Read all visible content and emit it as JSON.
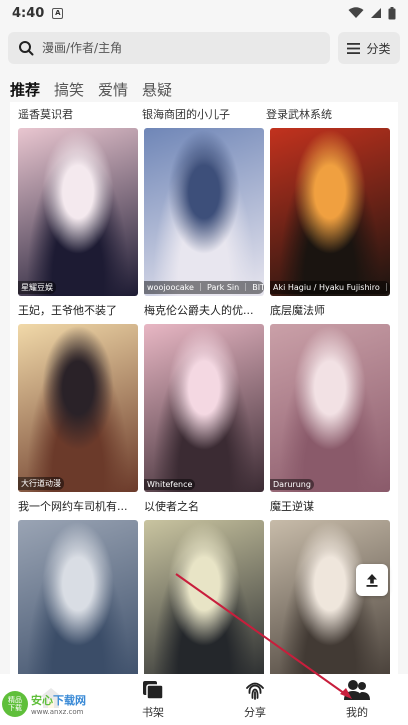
{
  "status_bar": {
    "time": "4:40",
    "notification": "A"
  },
  "search": {
    "placeholder": "漫画/作者/主角"
  },
  "category_button": {
    "label": "分类"
  },
  "tabs": [
    {
      "label": "推荐",
      "active": true
    },
    {
      "label": "搞笑",
      "active": false
    },
    {
      "label": "爱情",
      "active": false
    },
    {
      "label": "悬疑",
      "active": false
    }
  ],
  "previous_titles": [
    "遥香莫识君",
    "银海商团的小儿子",
    "登录武林系统"
  ],
  "comics": [
    {
      "title": "王妃，王爷他不装了",
      "author": "星耀豆娱",
      "colors": [
        "#e9c6d0",
        "#1d1b33",
        "#f4e9ee"
      ]
    },
    {
      "title": "梅克伦公爵夫人的优...",
      "author": "woojoocake ｜ Park Sin ｜ BITL...",
      "colors": [
        "#6f86b7",
        "#e8e6ef",
        "#3d4f7a"
      ]
    },
    {
      "title": "底层魔法师",
      "author": "Aki Hagiu / Hyaku Fujishiro ｜ ...",
      "colors": [
        "#c2321e",
        "#1a1410",
        "#f0a040"
      ]
    },
    {
      "title": "我一个网约车司机有...",
      "author": "大行道动漫",
      "colors": [
        "#f1d9a9",
        "#6b3a2a",
        "#2a2228"
      ]
    },
    {
      "title": "以使者之名",
      "author": "Whitefence",
      "colors": [
        "#e8b7c4",
        "#3b2b33",
        "#f4d8e2"
      ]
    },
    {
      "title": "魔王逆谋",
      "author": "Darurung",
      "colors": [
        "#caa0a8",
        "#8a5a6a",
        "#f2e1e4"
      ]
    },
    {
      "title": "",
      "author": "",
      "colors": [
        "#9aa4b4",
        "#3b4d68",
        "#d9dde4"
      ]
    },
    {
      "title": "",
      "author": "",
      "colors": [
        "#c9c4a0",
        "#24272b",
        "#e8e4c6"
      ]
    },
    {
      "title": "",
      "author": "",
      "colors": [
        "#c7bba9",
        "#423a34",
        "#efe6dc"
      ]
    }
  ],
  "bottom_nav": [
    {
      "label": "",
      "icon": "home-icon",
      "active": true
    },
    {
      "label": "书架",
      "icon": "bookshelf-icon",
      "active": false
    },
    {
      "label": "分享",
      "icon": "fingerprint-icon",
      "active": false
    },
    {
      "label": "我的",
      "icon": "user-icon",
      "active": false
    }
  ],
  "watermark": {
    "brand_a": "安心",
    "brand_b": "下载网",
    "url": "www.anxz.com",
    "logo_text": "精品\n下载"
  },
  "colors": {
    "accent": "#ffb400",
    "text": "#222222",
    "annotation": "#c81e3c"
  }
}
